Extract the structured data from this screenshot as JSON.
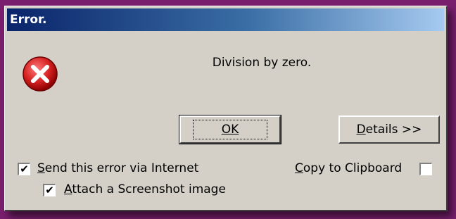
{
  "dialog": {
    "title": "Error.",
    "message": "Division by zero.",
    "icon": "error-icon",
    "colors": {
      "titlebar_start": "#0a246a",
      "titlebar_end": "#a6caf0",
      "icon_red": "#d42020",
      "dialog_bg": "#d4d0c8"
    }
  },
  "buttons": {
    "ok_label": "OK",
    "details_prefix": "D",
    "details_rest": "etails >>"
  },
  "options": {
    "send_error": {
      "label_accel": "S",
      "label_rest": "end this error via Internet",
      "checked": true,
      "mark": "✔"
    },
    "attach_screenshot": {
      "label_accel": "A",
      "label_rest": "ttach a Screenshot image",
      "checked": true,
      "mark": "✔"
    },
    "copy_clipboard": {
      "label_accel": "C",
      "label_rest": "opy to Clipboard",
      "checked": false,
      "mark": ""
    }
  }
}
